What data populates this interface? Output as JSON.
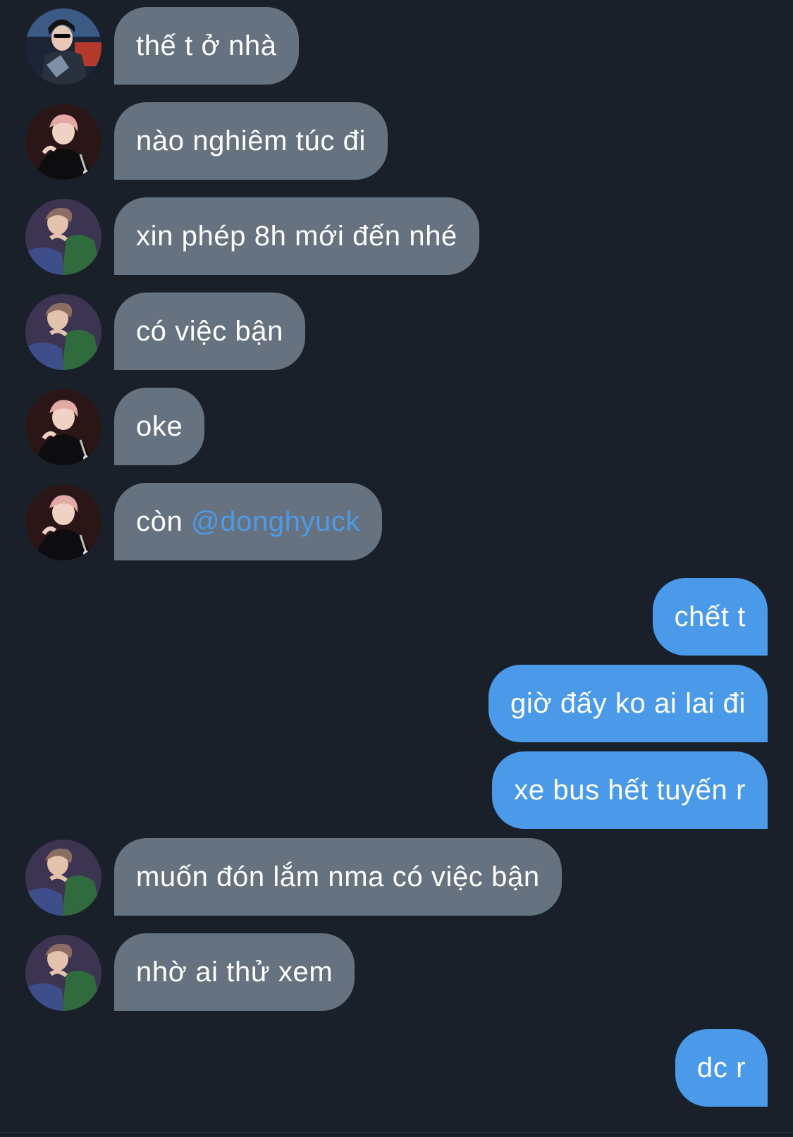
{
  "chat": {
    "messages": [
      {
        "direction": "incoming",
        "avatar": "avatar-sunglasses",
        "text": "thế t ở nhà"
      },
      {
        "direction": "incoming",
        "avatar": "avatar-pink-hair",
        "text": "nào nghiêm túc đi"
      },
      {
        "direction": "incoming",
        "avatar": "avatar-green-jacket",
        "text": "xin phép 8h mới đến nhé"
      },
      {
        "direction": "incoming",
        "avatar": "avatar-green-jacket",
        "text": "có việc bận"
      },
      {
        "direction": "incoming",
        "avatar": "avatar-pink-hair",
        "text": "oke"
      },
      {
        "direction": "incoming",
        "avatar": "avatar-pink-hair",
        "text": "còn ",
        "mention": "@donghyuck"
      },
      {
        "direction": "outgoing",
        "text": "chết t"
      },
      {
        "direction": "outgoing",
        "text": "giờ đấy ko ai lai đi"
      },
      {
        "direction": "outgoing",
        "text": "xe bus hết tuyến r"
      },
      {
        "direction": "incoming",
        "avatar": "avatar-green-jacket",
        "text": "muốn đón lắm nma có việc bận"
      },
      {
        "direction": "incoming",
        "avatar": "avatar-green-jacket",
        "text": "nhờ ai thử xem"
      },
      {
        "direction": "outgoing",
        "text": "dc r"
      }
    ]
  },
  "colors": {
    "background": "#19202a",
    "incoming_bubble": "#66727f",
    "outgoing_bubble": "#4a9ae9",
    "mention": "#4c9be8",
    "text": "#ffffff"
  }
}
